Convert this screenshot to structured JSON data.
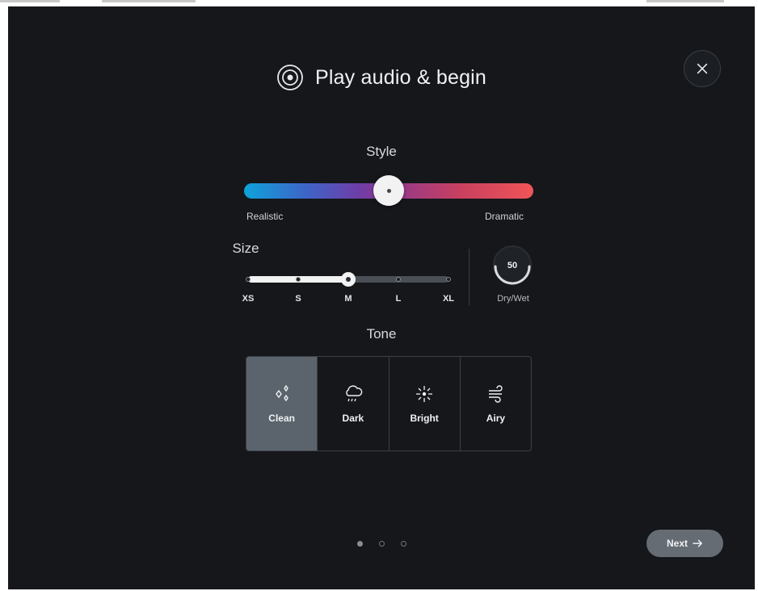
{
  "dialog": {
    "title": "Play audio & begin",
    "title_icon": "target-icon",
    "close_icon": "close-icon"
  },
  "style": {
    "label": "Style",
    "min_label": "Realistic",
    "max_label": "Dramatic",
    "value_fraction": 0.5,
    "gradient_colors": [
      "#0ea3da",
      "#6f3da6",
      "#f05558"
    ]
  },
  "size": {
    "label": "Size",
    "options": [
      "XS",
      "S",
      "M",
      "L",
      "XL"
    ],
    "selected": "M",
    "selected_index": 2
  },
  "drywet": {
    "value": "50",
    "caption": "Dry/Wet"
  },
  "tone": {
    "label": "Tone",
    "options": [
      {
        "label": "Clean",
        "icon": "sparkles-icon",
        "selected": true
      },
      {
        "label": "Dark",
        "icon": "cloud-rain-icon",
        "selected": false
      },
      {
        "label": "Bright",
        "icon": "sun-sparkle-icon",
        "selected": false
      },
      {
        "label": "Airy",
        "icon": "wind-icon",
        "selected": false
      }
    ]
  },
  "pager": {
    "count": 3,
    "active_index": 0
  },
  "next_button": {
    "label": "Next",
    "icon": "arrow-right-icon"
  },
  "colors": {
    "background": "#15171b",
    "selected_tone": "#5b646c",
    "next_button": "#656c73"
  }
}
